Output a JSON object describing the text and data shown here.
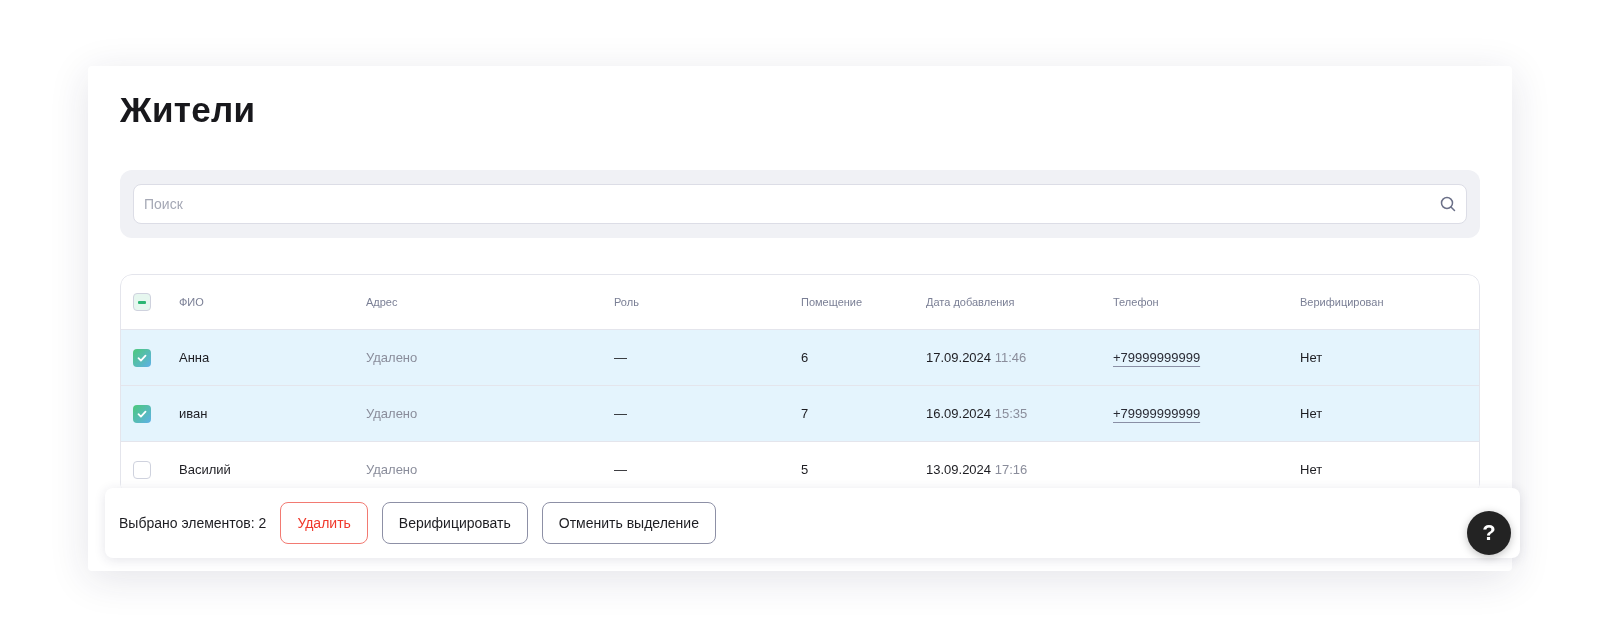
{
  "title": "Жители",
  "search": {
    "placeholder": "Поиск"
  },
  "table": {
    "select_all": {
      "indeterminate": true
    },
    "columns": [
      "ФИО",
      "Адрес",
      "Роль",
      "Помещение",
      "Дата добавления",
      "Телефон",
      "Верифицирован"
    ],
    "rows": [
      {
        "selected": true,
        "name": "Анна",
        "address": "Удалено",
        "role": "—",
        "room": "6",
        "date": "17.09.2024",
        "time": "11:46",
        "phone": "+79999999999",
        "verified": "Нет"
      },
      {
        "selected": true,
        "name": "иван",
        "address": "Удалено",
        "role": "—",
        "room": "7",
        "date": "16.09.2024",
        "time": "15:35",
        "phone": "+79999999999",
        "verified": "Нет"
      },
      {
        "selected": false,
        "name": "Василий",
        "address": "Удалено",
        "role": "—",
        "room": "5",
        "date": "13.09.2024",
        "time": "17:16",
        "verified": "Нет"
      }
    ]
  },
  "action_bar": {
    "count_label": "Выбрано элементов: 2",
    "buttons": [
      {
        "label": "Удалить",
        "kind": "danger"
      },
      {
        "label": "Верифицировать",
        "kind": "outline"
      },
      {
        "label": "Отменить выделение",
        "kind": "outline"
      }
    ]
  },
  "help_button": {
    "label": "?"
  }
}
